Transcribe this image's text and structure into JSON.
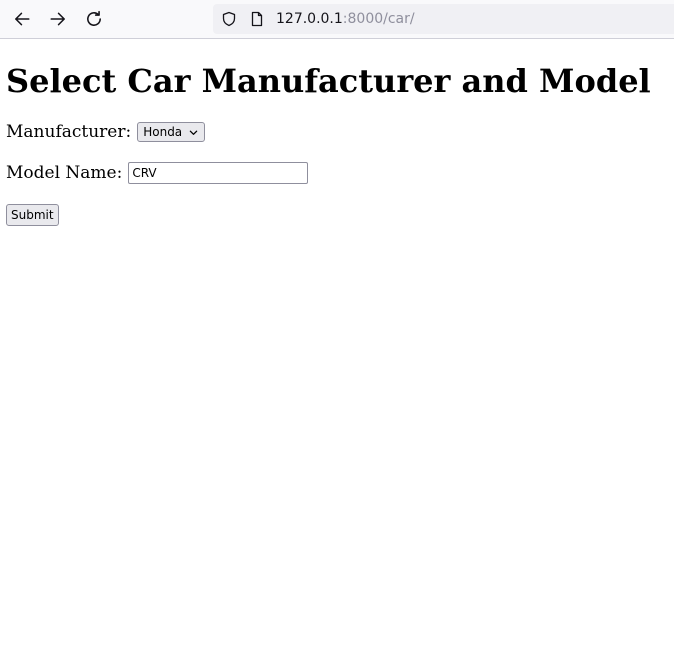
{
  "browser": {
    "url_host": "127.0.0.1",
    "url_path": ":8000/car/",
    "back_icon": "back-arrow-icon",
    "forward_icon": "forward-arrow-icon",
    "reload_icon": "reload-icon",
    "shield_icon": "tracking-shield-icon",
    "page_icon": "page-document-icon"
  },
  "page": {
    "heading": "Select Car Manufacturer and Model",
    "manufacturer_label": "Manufacturer:",
    "manufacturer_selected": "Honda",
    "model_label": "Model Name:",
    "model_value": "CRV",
    "submit_label": "Submit"
  }
}
